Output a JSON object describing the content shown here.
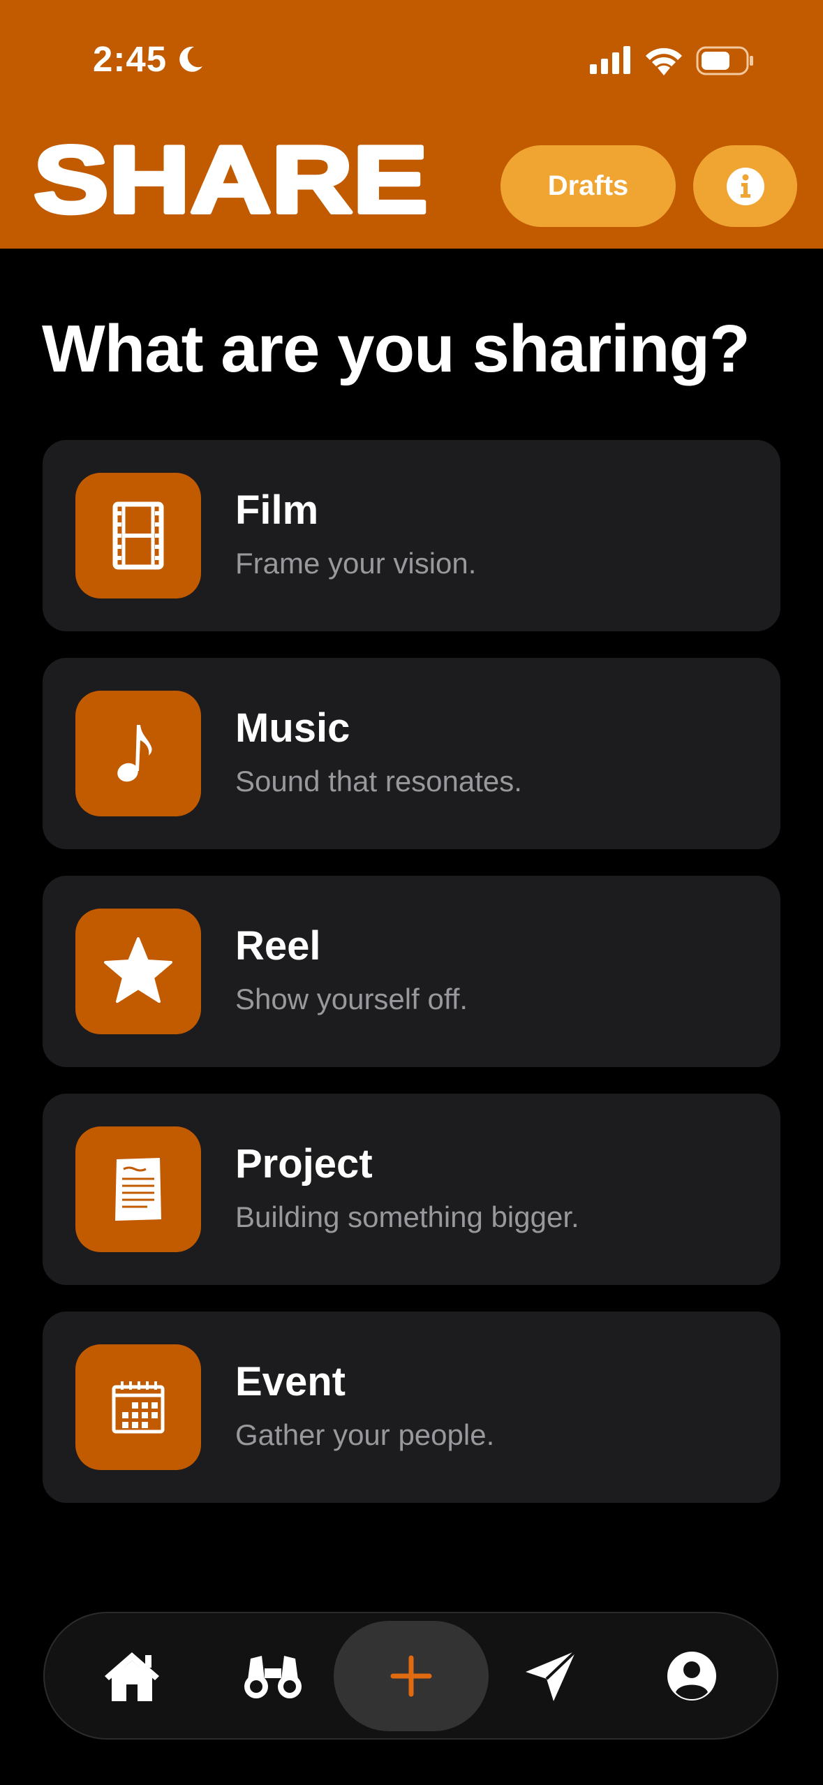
{
  "status_bar": {
    "time": "2:45",
    "icons": [
      "moon-icon",
      "cellular-signal-icon",
      "wifi-icon",
      "battery-icon"
    ]
  },
  "header": {
    "title": "SHARE",
    "drafts_label": "Drafts",
    "info_icon": "info-icon"
  },
  "main": {
    "heading": "What are you sharing?",
    "options": [
      {
        "title": "Film",
        "subtitle": "Frame your vision.",
        "icon": "film-strip-icon"
      },
      {
        "title": "Music",
        "subtitle": "Sound that resonates.",
        "icon": "music-note-icon"
      },
      {
        "title": "Reel",
        "subtitle": "Show yourself off.",
        "icon": "star-icon"
      },
      {
        "title": "Project",
        "subtitle": "Building something bigger.",
        "icon": "document-icon"
      },
      {
        "title": "Event",
        "subtitle": "Gather your people.",
        "icon": "calendar-icon"
      }
    ]
  },
  "bottom_nav": {
    "items": [
      "home-icon",
      "binoculars-icon",
      "plus-icon",
      "paper-plane-icon",
      "profile-icon"
    ],
    "active": "plus-icon"
  },
  "colors": {
    "brand_orange": "#c25a00",
    "button_amber": "#f0a532",
    "card_background": "#1c1c1e",
    "subtitle_gray": "#98989d",
    "background": "#000000"
  }
}
